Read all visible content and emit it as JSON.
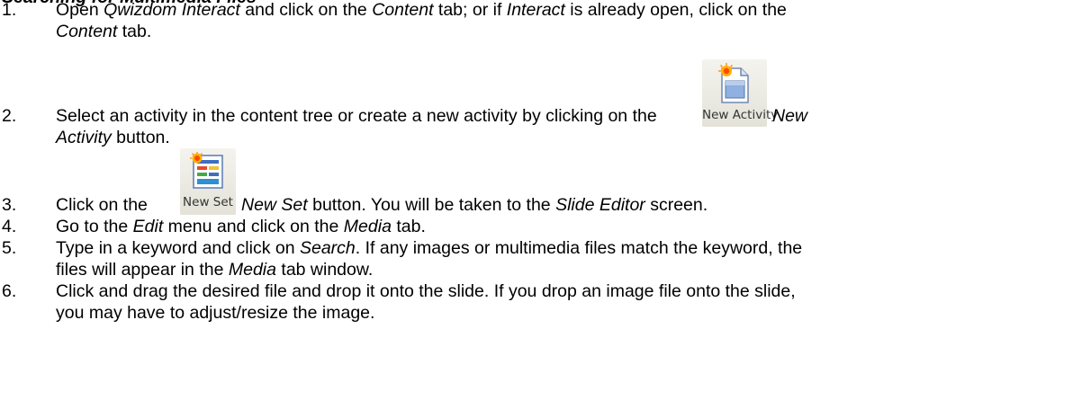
{
  "heading": "Searching for Multimedia Files",
  "steps": [
    {
      "num": "1.",
      "lines": [
        [
          {
            "t": "Open ",
            "i": false
          },
          {
            "t": "Qwizdom Interact",
            "i": true
          },
          {
            "t": " and click on the ",
            "i": false
          },
          {
            "t": "Content",
            "i": true
          },
          {
            "t": " tab; or if ",
            "i": false
          },
          {
            "t": "Interact",
            "i": true
          },
          {
            "t": " is already open, click on the",
            "i": false
          }
        ],
        [
          {
            "t": "Content",
            "i": true
          },
          {
            "t": " tab.",
            "i": false
          }
        ]
      ]
    },
    {
      "num": "2.",
      "lines": [
        [
          {
            "t": "Select an activity in the content tree or create a new activity by clicking on the",
            "i": false
          }
        ],
        [
          {
            "t": "Activity",
            "i": true
          },
          {
            "t": " button.",
            "i": false
          }
        ]
      ],
      "after_button": [
        {
          "t": "New",
          "i": true
        }
      ]
    },
    {
      "num": "3.",
      "lines": [
        [
          {
            "t": "Click on the",
            "i": false
          }
        ]
      ],
      "after_button": [
        {
          "t": "New Set",
          "i": true
        },
        {
          "t": " button.  You will be taken to the ",
          "i": false
        },
        {
          "t": "Slide Editor",
          "i": true
        },
        {
          "t": " screen.",
          "i": false
        }
      ]
    },
    {
      "num": "4.",
      "lines": [
        [
          {
            "t": "Go to the ",
            "i": false
          },
          {
            "t": "Edit",
            "i": true
          },
          {
            "t": " menu and click on the ",
            "i": false
          },
          {
            "t": "Media",
            "i": true
          },
          {
            "t": " tab.",
            "i": false
          }
        ]
      ]
    },
    {
      "num": "5.",
      "lines": [
        [
          {
            "t": "Type in a keyword and click on ",
            "i": false
          },
          {
            "t": "Search",
            "i": true
          },
          {
            "t": ".  If any images or multimedia files match the keyword, the",
            "i": false
          }
        ],
        [
          {
            "t": "files will appear in the ",
            "i": false
          },
          {
            "t": "Media",
            "i": true
          },
          {
            "t": " tab window.",
            "i": false
          }
        ]
      ]
    },
    {
      "num": "6.",
      "lines": [
        [
          {
            "t": "Click and drag the desired file and drop it onto the slide.  If you drop an image file onto the slide,",
            "i": false
          }
        ],
        [
          {
            "t": "you may have to adjust/resize the image.",
            "i": false
          }
        ]
      ]
    }
  ],
  "buttons": {
    "new_activity": {
      "label": "New Activity",
      "icon": "new-activity-icon"
    },
    "new_set": {
      "label": "New Set",
      "icon": "new-set-icon"
    }
  }
}
